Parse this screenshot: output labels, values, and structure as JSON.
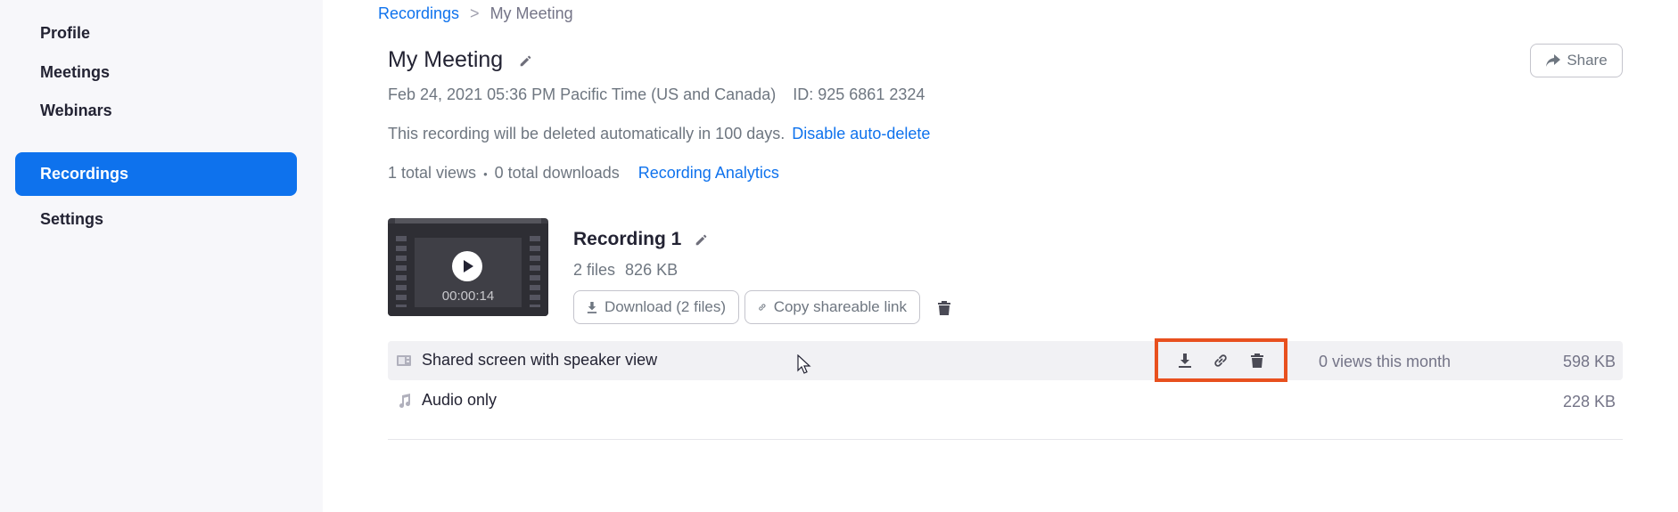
{
  "sidebar": {
    "items": [
      {
        "label": "Profile",
        "active": false
      },
      {
        "label": "Meetings",
        "active": false
      },
      {
        "label": "Webinars",
        "active": false
      },
      {
        "label": "Recordings",
        "active": true
      },
      {
        "label": "Settings",
        "active": false
      }
    ]
  },
  "breadcrumb": {
    "parent": "Recordings",
    "separator": ">",
    "current": "My Meeting"
  },
  "meeting": {
    "title": "My Meeting",
    "datetime": "Feb 24, 2021 05:36 PM Pacific Time (US and Canada)",
    "id_label": "ID: 925 6861 2324",
    "auto_delete_notice": "This recording will be deleted automatically in 100 days.",
    "disable_auto_delete": "Disable auto-delete",
    "views": "1 total views",
    "dot": "•",
    "downloads": "0 total downloads",
    "analytics_link": "Recording Analytics",
    "share_label": "Share"
  },
  "recording": {
    "title": "Recording 1",
    "files_count": "2 files",
    "total_size": "826 KB",
    "duration": "00:00:14",
    "download_label": "Download (2 files)",
    "copy_link_label": "Copy shareable link"
  },
  "files": [
    {
      "name": "Shared screen with speaker view",
      "views": "0 views this month",
      "size": "598 KB"
    },
    {
      "name": "Audio only",
      "views": "",
      "size": "228 KB"
    }
  ],
  "colors": {
    "accent": "#0e72ed",
    "highlight_box": "#e8501e",
    "sidebar_bg": "#f7f7fa"
  }
}
